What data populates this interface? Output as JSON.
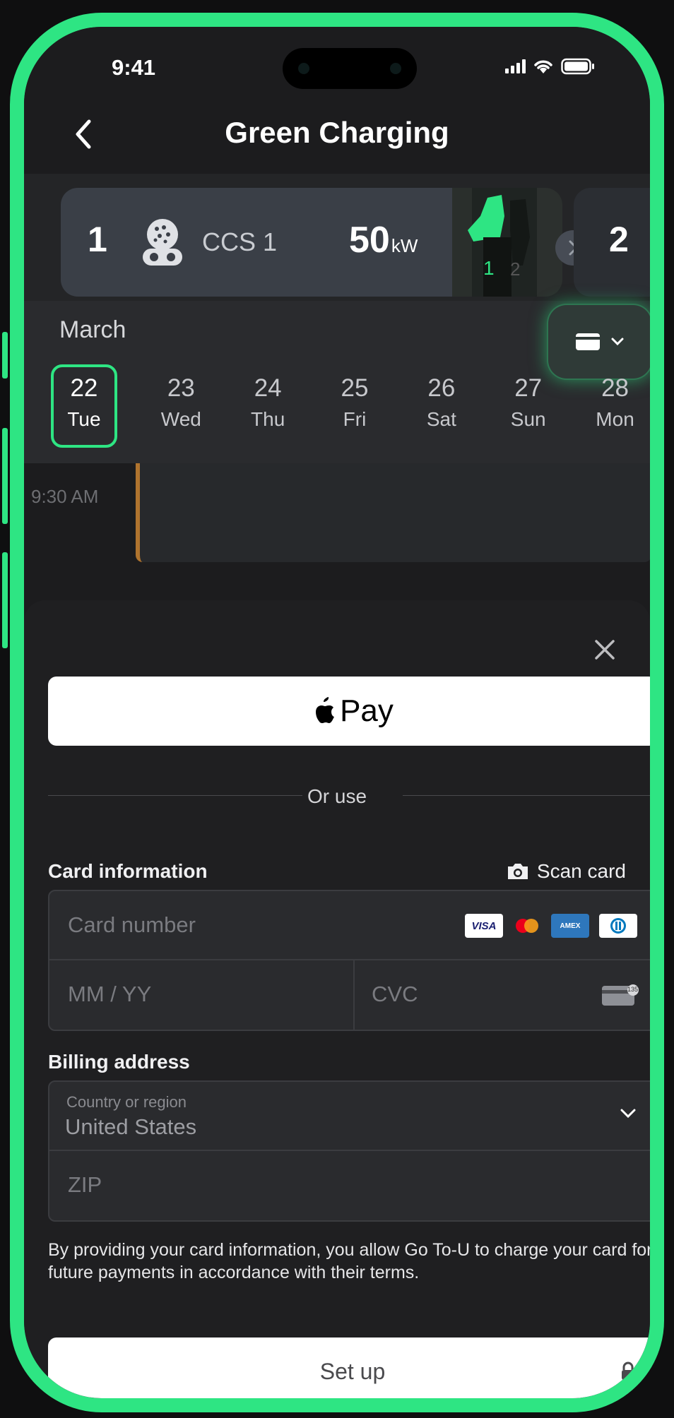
{
  "status_bar": {
    "time": "9:41"
  },
  "header": {
    "title": "Green Charging"
  },
  "charger": {
    "number": "1",
    "connector_type": "CCS 1",
    "power_value": "50",
    "power_unit": "kW",
    "photo_labels": [
      "1",
      "2"
    ],
    "next_number": "2"
  },
  "calendar": {
    "month": "March",
    "days": [
      {
        "date": "22",
        "weekday": "Tue",
        "selected": true
      },
      {
        "date": "23",
        "weekday": "Wed"
      },
      {
        "date": "24",
        "weekday": "Thu"
      },
      {
        "date": "25",
        "weekday": "Fri"
      },
      {
        "date": "26",
        "weekday": "Sat"
      },
      {
        "date": "27",
        "weekday": "Sun"
      },
      {
        "date": "28",
        "weekday": "Mon"
      }
    ]
  },
  "schedule": {
    "time_label": "9:30 AM",
    "accent": "#b0742e"
  },
  "payment": {
    "apple_pay_label": "Pay",
    "divider_text": "Or use",
    "card_section_label": "Card information",
    "scan_label": "Scan card",
    "card_number_placeholder": "Card number",
    "expiry_placeholder": "MM / YY",
    "cvc_placeholder": "CVC",
    "brand_visa": "VISA",
    "brand_amex": "AMEX",
    "cvc_icon_text": "135",
    "billing_label": "Billing address",
    "country_label": "Country or region",
    "country_value": "United States",
    "zip_placeholder": "ZIP",
    "legal_text": "By providing your card information, you allow Go To-U to charge your card for future payments in accordance with their terms.",
    "setup_label": "Set up"
  },
  "colors": {
    "accent": "#2ee583",
    "background": "#1c1c1e"
  }
}
